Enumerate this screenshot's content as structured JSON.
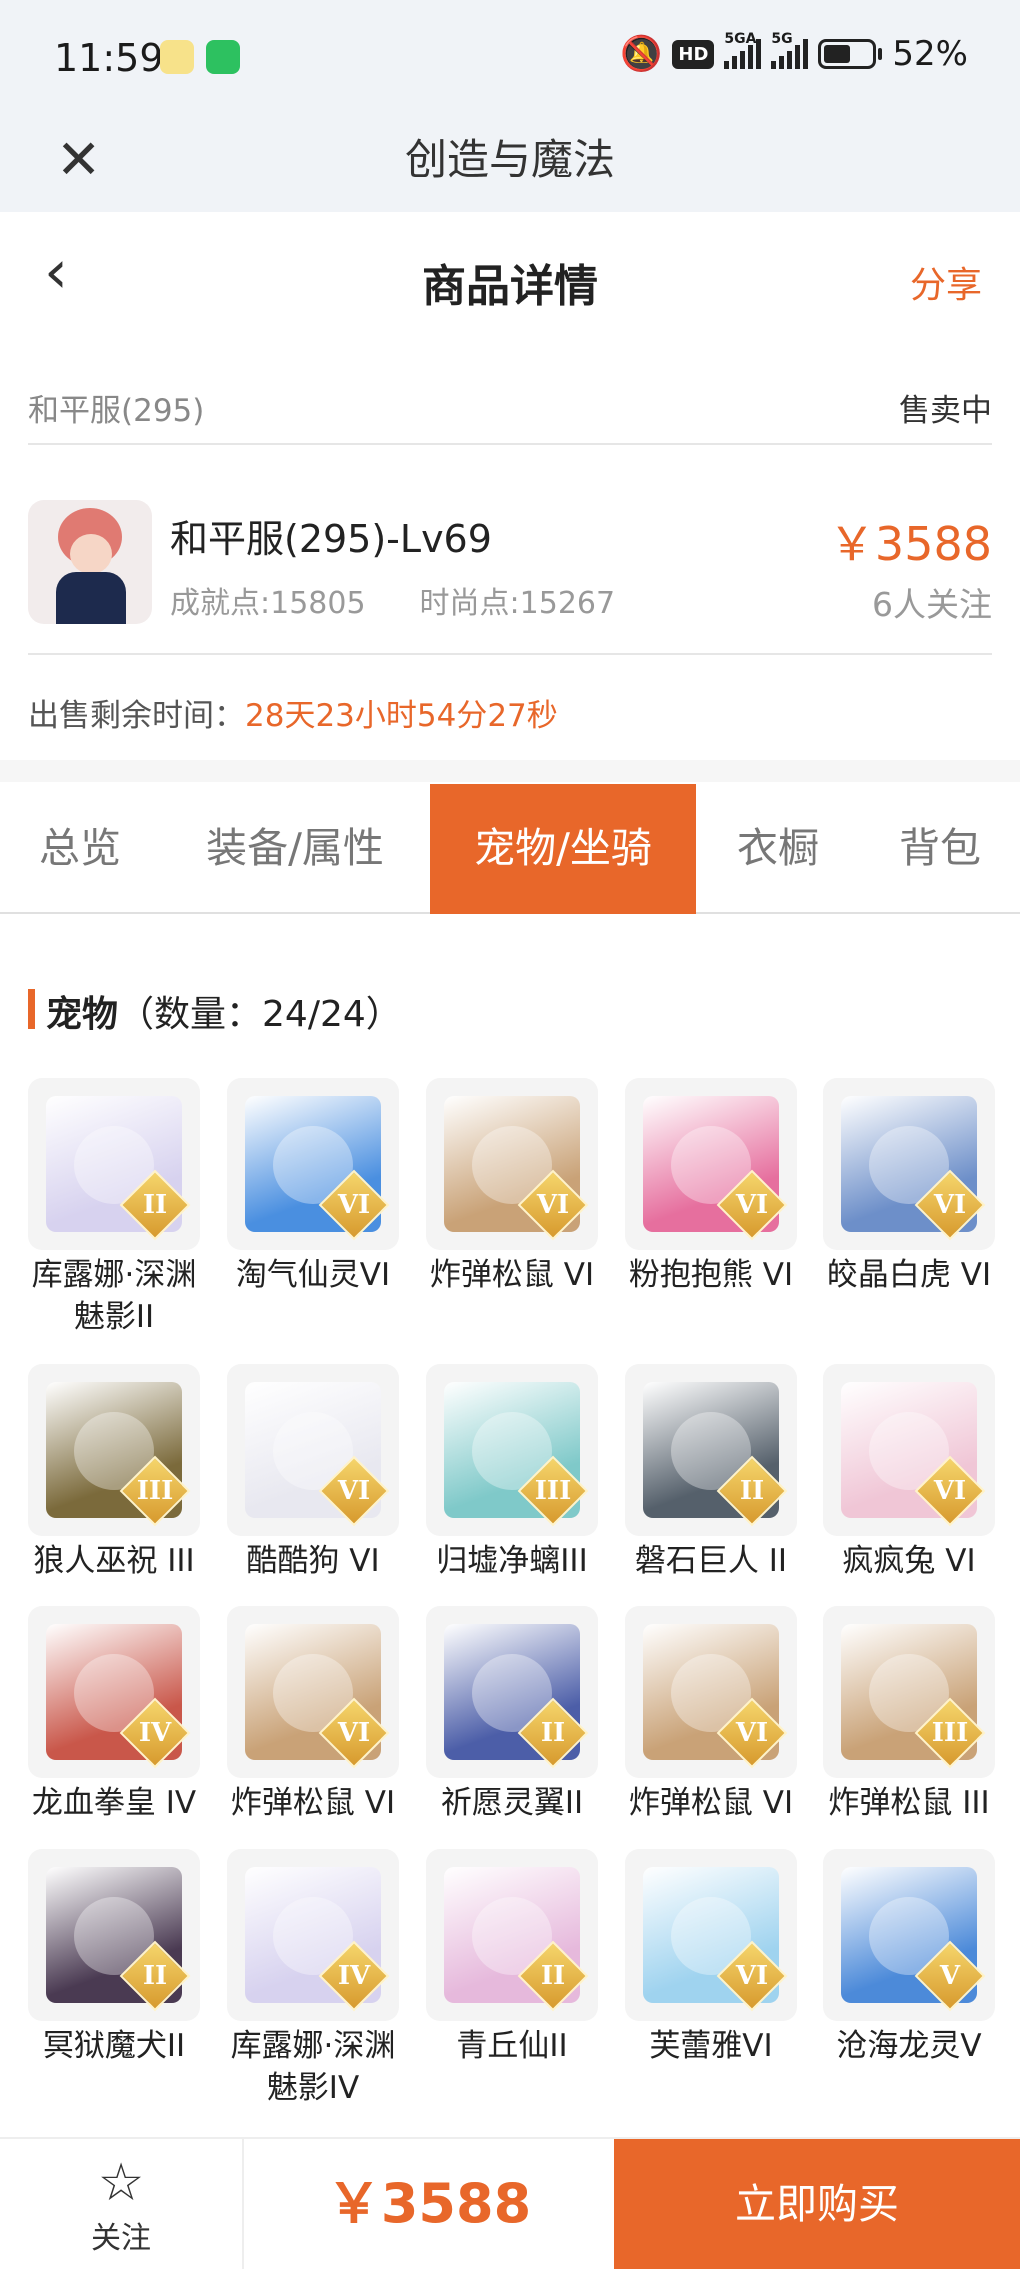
{
  "status_bar": {
    "time": "11:59",
    "battery": "52%",
    "hd": "HD",
    "sig1": "5GA",
    "sig2": "5G"
  },
  "nav": {
    "title": "创造与魔法"
  },
  "header": {
    "title": "商品详情",
    "share": "分享"
  },
  "server": {
    "name": "和平服(295)",
    "status": "售卖中"
  },
  "product": {
    "name": "和平服(295)-Lv69",
    "achievement": "成就点:15805",
    "fashion": "时尚点:15267",
    "price": "￥3588",
    "followers": "6人关注"
  },
  "remaining": {
    "label": "出售剩余时间：",
    "value": "28天23小时54分27秒"
  },
  "tabs": [
    "总览",
    "装备/属性",
    "宠物/坐骑",
    "衣橱",
    "背包"
  ],
  "active_tab": "宠物/坐骑",
  "section": {
    "title": "宠物",
    "count": "（数量：24/24）"
  },
  "pets": [
    {
      "name": "库露娜·深渊魅影II",
      "grade": "II",
      "color": "#d7d2ef"
    },
    {
      "name": "淘气仙灵VI",
      "grade": "VI",
      "color": "#4a8fe0"
    },
    {
      "name": "炸弹松鼠 VI",
      "grade": "VI",
      "color": "#c9a277"
    },
    {
      "name": "粉抱抱熊 VI",
      "grade": "VI",
      "color": "#e66f9e"
    },
    {
      "name": "皎晶白虎 VI",
      "grade": "VI",
      "color": "#6d8fc9"
    },
    {
      "name": "狼人巫祝 III",
      "grade": "III",
      "color": "#7b6a3b"
    },
    {
      "name": "酷酷狗 VI",
      "grade": "VI",
      "color": "#e8e8f0"
    },
    {
      "name": "归墟净螭III",
      "grade": "III",
      "color": "#7fc9c9"
    },
    {
      "name": "磐石巨人 II",
      "grade": "II",
      "color": "#55606b"
    },
    {
      "name": "疯疯兔 VI",
      "grade": "VI",
      "color": "#f0c6d6"
    },
    {
      "name": "龙血拳皇 IV",
      "grade": "IV",
      "color": "#c9574a"
    },
    {
      "name": "炸弹松鼠 VI",
      "grade": "VI",
      "color": "#c9a277"
    },
    {
      "name": "祈愿灵翼II",
      "grade": "II",
      "color": "#4c5ea8"
    },
    {
      "name": "炸弹松鼠 VI",
      "grade": "VI",
      "color": "#c9a277"
    },
    {
      "name": "炸弹松鼠 III",
      "grade": "III",
      "color": "#c9a277"
    },
    {
      "name": "冥狱魔犬II",
      "grade": "II",
      "color": "#4a3a52"
    },
    {
      "name": "库露娜·深渊魅影IV",
      "grade": "IV",
      "color": "#d7d2ef"
    },
    {
      "name": "青丘仙II",
      "grade": "II",
      "color": "#e6b9dc"
    },
    {
      "name": "芙蕾雅VI",
      "grade": "VI",
      "color": "#9fd3ef"
    },
    {
      "name": "沧海龙灵V",
      "grade": "V",
      "color": "#4c8ad9"
    }
  ],
  "bottom": {
    "follow": "关注",
    "price": "￥3588",
    "buy": "立即购买"
  },
  "colors": {
    "accent": "#e8672a"
  }
}
